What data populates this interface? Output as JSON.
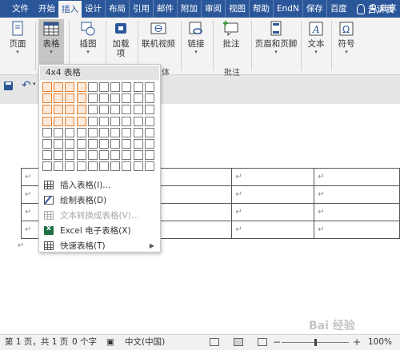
{
  "tabs": [
    {
      "label": "文件"
    },
    {
      "label": "开始"
    },
    {
      "label": "插入",
      "active": true
    },
    {
      "label": "设计"
    },
    {
      "label": "布局"
    },
    {
      "label": "引用"
    },
    {
      "label": "邮件"
    },
    {
      "label": "附加"
    },
    {
      "label": "审阅"
    },
    {
      "label": "视图"
    },
    {
      "label": "帮助"
    },
    {
      "label": "EndN"
    },
    {
      "label": "保存"
    },
    {
      "label": "百度"
    }
  ],
  "tell_me": "告诉我",
  "share": "共享",
  "ribbon": {
    "pages": "页面",
    "table": "表格",
    "illustrations": "插图",
    "addins_line1": "加载",
    "addins_line2": "项",
    "online_video": "联机视频",
    "media_group_fragment": "体",
    "links": "链接",
    "comment": "批注",
    "comment_group": "批注",
    "header_footer": "页眉和页脚",
    "text": "文本",
    "symbols": "符号"
  },
  "table_menu": {
    "title": "4x4 表格",
    "grid_cols": 10,
    "grid_rows": 8,
    "selected_cols": 4,
    "selected_rows": 4,
    "items": [
      {
        "label": "插入表格(I)...",
        "enabled": true
      },
      {
        "label": "绘制表格(D)",
        "enabled": true
      },
      {
        "label": "文本转换成表格(V)...",
        "enabled": false
      },
      {
        "label": "Excel 电子表格(X)",
        "enabled": true
      },
      {
        "label": "快速表格(T)",
        "enabled": true,
        "submenu": true
      }
    ]
  },
  "document": {
    "paragraph_mark": "↵",
    "rows": 4,
    "cols": 4
  },
  "status": {
    "page": "第 1 页，共 1 页",
    "words": "0 个字",
    "language": "中文(中国)",
    "zoom": "100%",
    "zoom_minus": "−",
    "zoom_plus": "+"
  },
  "watermark": "Bai 经验"
}
